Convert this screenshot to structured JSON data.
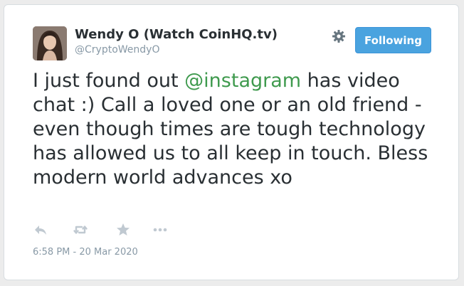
{
  "author": {
    "display_name": "Wendy O (Watch CoinHQ.tv)",
    "handle": "@CryptoWendyO"
  },
  "follow_button": {
    "label": "Following"
  },
  "tweet": {
    "text_before": "I just found out ",
    "mention": "@instagram",
    "text_after": " has video chat :) Call a loved one or an old friend - even though times are tough technology has allowed us to all keep in touch. Bless modern world advances xo",
    "timestamp": "6:58 PM - 20 Mar 2020"
  },
  "icons": {
    "settings": "gear-icon",
    "reply": "reply-icon",
    "retweet": "retweet-icon",
    "like": "star-icon",
    "more": "more-icon"
  },
  "colors": {
    "follow_button_bg": "#4aa3df",
    "mention": "#3f9a4e",
    "text": "#292f33",
    "muted": "#8899a6",
    "icon": "#c0c9d1"
  }
}
